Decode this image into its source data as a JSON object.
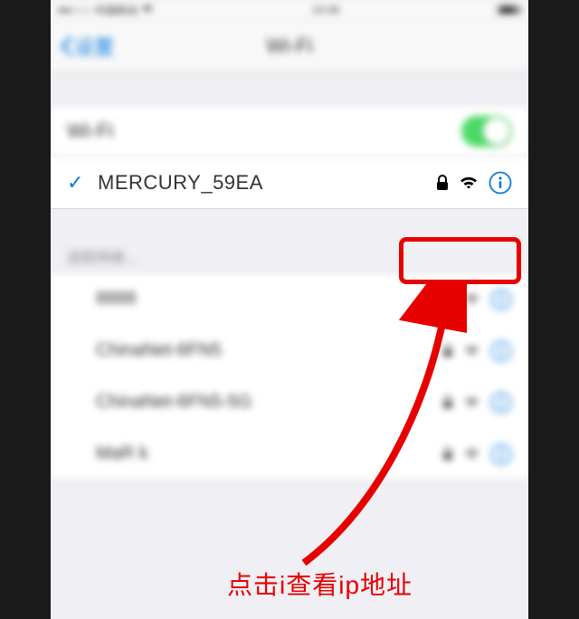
{
  "statusbar": {
    "carrier": "中国移动",
    "time": "10:36"
  },
  "navbar": {
    "back_label": "设置",
    "title": "Wi-Fi"
  },
  "wifi_row": {
    "label": "Wi-Fi",
    "enabled": true
  },
  "connected": {
    "ssid": "MERCURY_59EA",
    "secured": true
  },
  "section_label": "选取网络...",
  "networks": [
    {
      "ssid": "8888",
      "secured": true
    },
    {
      "ssid": "ChinaNet-6FN5",
      "secured": true
    },
    {
      "ssid": "ChinaNet-6FN5-5G",
      "secured": true
    },
    {
      "ssid": "MaR k",
      "secured": true
    }
  ],
  "annotation": "点击i查看ip地址",
  "colors": {
    "highlight": "#e60000",
    "tint": "#0b7ae0",
    "toggle": "#4cd964"
  }
}
